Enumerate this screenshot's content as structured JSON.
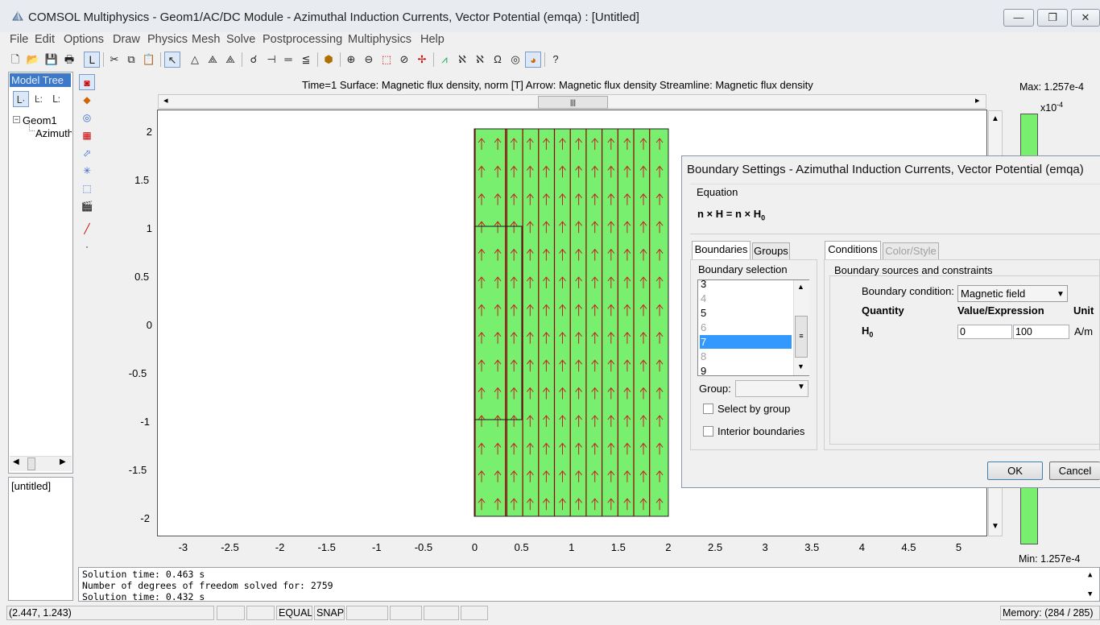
{
  "window": {
    "title": "COMSOL Multiphysics - Geom1/AC/DC Module - Azimuthal Induction Currents, Vector Potential (emqa) : [Untitled]",
    "minimize": "▭",
    "maximize": "❐",
    "close": "✕"
  },
  "menubar": [
    "File",
    "Edit",
    "Options",
    "Draw",
    "Physics",
    "Mesh",
    "Solve",
    "Postprocessing",
    "Multiphysics",
    "Help"
  ],
  "toolbar_icons": [
    "new-file-icon",
    "open-icon",
    "save-icon",
    "print-icon",
    "model-tree-icon",
    "cut-icon",
    "copy-icon",
    "paste-icon",
    "select-icon",
    "draw-triangle-icon",
    "draw-mesh-icon",
    "refine-mesh-icon",
    "subdomain-icon",
    "boundary-icon",
    "equal-icon",
    "point-icon",
    "geometry-icon",
    "zoom-in-icon",
    "zoom-out-icon",
    "zoom-window-icon",
    "zoom-extents-icon",
    "move-icon",
    "plot-icon",
    "function-icon",
    "integrate-icon",
    "omega-icon",
    "sphere-icon",
    "colormap-icon",
    "help-icon"
  ],
  "model_tree": {
    "tab_label": "Model Tree",
    "geom_node": "Geom1",
    "child_node": "Azimuth",
    "untitled": "[untitled]"
  },
  "plot": {
    "header": "Time=1   Surface: Magnetic flux density, norm [T]   Arrow: Magnetic flux density   Streamline: Magnetic flux density",
    "x_ticks": [
      "-3",
      "-2.5",
      "-2",
      "-1.5",
      "-1",
      "-0.5",
      "0",
      "0.5",
      "1",
      "1.5",
      "2",
      "2.5",
      "3",
      "3.5",
      "4",
      "4.5",
      "5"
    ],
    "y_ticks": [
      "2",
      "1.5",
      "1",
      "0.5",
      "0",
      "-0.5",
      "-1",
      "-1.5",
      "-2"
    ],
    "colors": {
      "surface": "#79ef70",
      "arrow": "#c42020",
      "line": "#8b0000"
    }
  },
  "colorbar": {
    "max": "Max: 1.257e-4",
    "exponent": "x10",
    "exponent_power": "-4",
    "min": "Min: 1.257e-4"
  },
  "dialog": {
    "title": "Boundary Settings - Azimuthal Induction Currents, Vector Potential (emqa)",
    "equation_label": "Equation",
    "equation": "n × H = n × H",
    "equation_sub": "0",
    "tabs_left": [
      "Boundaries",
      "Groups"
    ],
    "boundary_selection_label": "Boundary selection",
    "boundaries": [
      {
        "id": "3",
        "state": "normal"
      },
      {
        "id": "4",
        "state": "disabled"
      },
      {
        "id": "5",
        "state": "normal"
      },
      {
        "id": "6",
        "state": "disabled"
      },
      {
        "id": "7",
        "state": "selected"
      },
      {
        "id": "8",
        "state": "disabled"
      },
      {
        "id": "9",
        "state": "normal"
      }
    ],
    "group_label": "Group:",
    "group_value": "",
    "select_by_group": "Select by group",
    "interior_boundaries": "Interior boundaries",
    "tabs_right": [
      "Conditions",
      "Color/Style"
    ],
    "sources_label": "Boundary sources and constraints",
    "boundary_condition_label": "Boundary condition:",
    "boundary_condition_value": "Magnetic field",
    "col_quantity": "Quantity",
    "col_value": "Value/Expression",
    "col_unit": "Unit",
    "quantity_symbol": "H",
    "quantity_sub": "0",
    "value_r": "0",
    "value_z": "100",
    "unit": "A/m",
    "ok": "OK",
    "cancel": "Cancel"
  },
  "log": [
    "Solution time: 0.463 s",
    "Number of degrees of freedom solved for: 2759",
    "Solution time: 0.432 s"
  ],
  "statusbar": {
    "coords": "(2.447, 1.243)",
    "equal": "EQUAL",
    "snap": "SNAP",
    "memory": "Memory: (284 / 285)"
  }
}
